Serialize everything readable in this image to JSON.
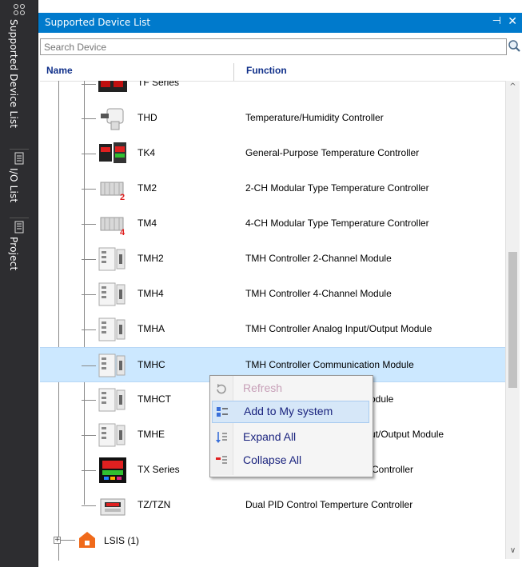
{
  "sidebar": {
    "tabs": [
      {
        "label": "Supported Device List",
        "icon": "device-list-icon"
      },
      {
        "label": "I/O List",
        "icon": "io-list-icon"
      },
      {
        "label": "Project",
        "icon": "project-icon"
      }
    ]
  },
  "panel": {
    "title": "Supported Device List",
    "pin_glyph": "⊣",
    "close_glyph": "✕"
  },
  "search": {
    "placeholder": "Search Device"
  },
  "columns": {
    "name": "Name",
    "function": "Function"
  },
  "rows": [
    {
      "name": "TF Series",
      "function": "",
      "icon": "tf-series-thumb"
    },
    {
      "name": "THD",
      "function": "Temperature/Humidity Controller",
      "icon": "thd-thumb"
    },
    {
      "name": "TK4",
      "function": "General-Purpose Temperature Controller",
      "icon": "tk4-thumb"
    },
    {
      "name": "TM2",
      "function": "2-CH Modular Type Temperature Controller",
      "icon": "tm2-thumb"
    },
    {
      "name": "TM4",
      "function": "4-CH Modular Type Temperature Controller",
      "icon": "tm4-thumb"
    },
    {
      "name": "TMH2",
      "function": "TMH Controller 2-Channel Module",
      "icon": "tmh-module-thumb"
    },
    {
      "name": "TMH4",
      "function": "TMH Controller 4-Channel Module",
      "icon": "tmh-module-thumb"
    },
    {
      "name": "TMHA",
      "function": "TMH Controller Analog Input/Output Module",
      "icon": "tmh-module-thumb"
    },
    {
      "name": "TMHC",
      "function": "TMH Controller Communication Module",
      "icon": "tmh-module-thumb"
    },
    {
      "name": "TMHCT",
      "function": "Module",
      "icon": "tmh-module-thumb"
    },
    {
      "name": "TMHE",
      "function": "ut/Output Module",
      "icon": "tmh-module-thumb"
    },
    {
      "name": "TX Series",
      "function": "Controller",
      "icon": "tx-series-thumb"
    },
    {
      "name": "TZ/TZN",
      "function": "Dual PID Control Temperture Controller",
      "icon": "tz-thumb"
    }
  ],
  "selected_row": "TMHC",
  "group": {
    "name": "LSIS (1)",
    "icon": "home-icon"
  },
  "context_menu": {
    "items": [
      {
        "label": "Refresh",
        "icon": "refresh-icon",
        "enabled": false
      },
      {
        "label": "Add to My system",
        "icon": "add-system-icon",
        "enabled": true,
        "highlighted": true
      },
      {
        "label": "Expand All",
        "icon": "expand-all-icon",
        "enabled": true
      },
      {
        "label": "Collapse All",
        "icon": "collapse-all-icon",
        "enabled": true
      }
    ]
  },
  "colors": {
    "accent": "#007acc",
    "sidebar": "#2d2d30",
    "header_text": "#10308a",
    "selection": "#cce8ff"
  }
}
